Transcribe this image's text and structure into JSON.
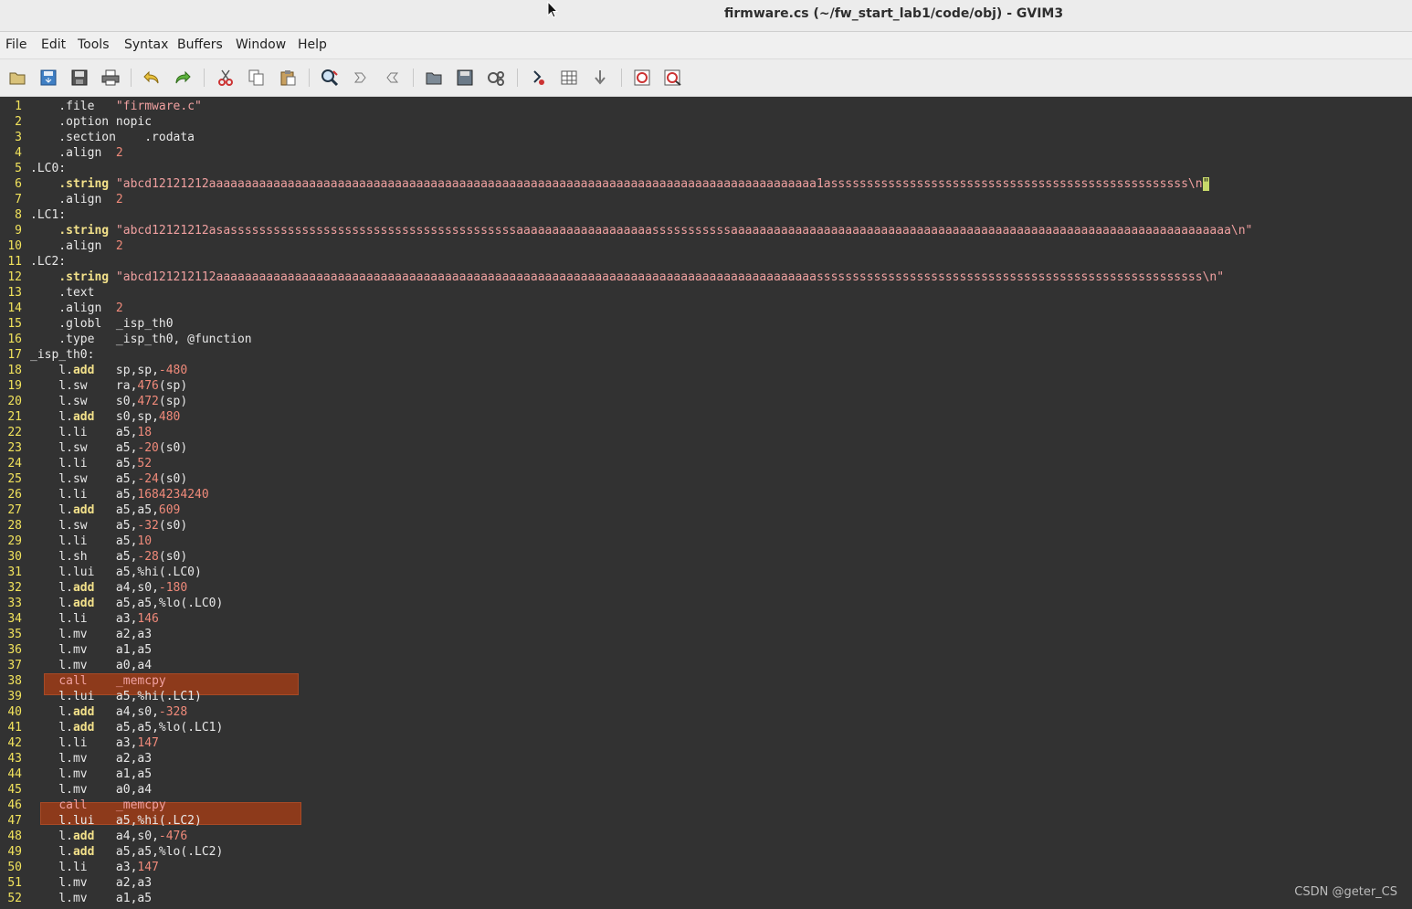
{
  "window": {
    "title": "firmware.cs (~/fw_start_lab1/code/obj) - GVIM3"
  },
  "menu": [
    "File",
    "Edit",
    "Tools",
    "Syntax",
    "Buffers",
    "Window",
    "Help"
  ],
  "toolbar": [
    "open-icon",
    "save-icon",
    "save-all-icon",
    "print-icon",
    "undo-icon",
    "redo-icon",
    "cut-icon",
    "copy-icon",
    "paste-icon",
    "find-replace-icon",
    "find-next-icon",
    "find-prev-icon",
    "load-session-icon",
    "save-session-icon",
    "run-script-icon",
    "make-icon",
    "build-tags-icon",
    "jump-to-tag-icon",
    "help-icon",
    "find-help-icon"
  ],
  "watermark": "CSDN @geter_CS",
  "colors": {
    "linenum": "#f2e35c",
    "keyword": "#f3e18a",
    "string": "#f0a0a0",
    "number": "#f08a7a",
    "highlight": "#8d3a1b",
    "background": "#323232"
  },
  "lines": [
    {
      "n": "1",
      "t": "    .file   \"firmware.c\""
    },
    {
      "n": "2",
      "t": "    .option nopic"
    },
    {
      "n": "3",
      "t": "    .section    .rodata"
    },
    {
      "n": "4",
      "t": "    .align  2"
    },
    {
      "n": "5",
      "t": ".LC0:"
    },
    {
      "n": "6",
      "t": "    .string \"abcd12121212aaaaaaaaaaaaaaaaaaaaaaaaaaaaaaaaaaaaaaaaaaaaaaaaaaaaaaaaaaaaaaaaaaaaaaaaaaaaaaaaaaaaa1assssssssssssssssssssssssssssssssssssssssssssssssss\\n\""
    },
    {
      "n": "7",
      "t": "    .align  2"
    },
    {
      "n": "8",
      "t": ".LC1:"
    },
    {
      "n": "9",
      "t": "    .string \"abcd12121212asassssssssssssssssssssssssssssssssssssssssaaaaaaaaaaaaaaaaaaasssssssssssaaaaaaaaaaaaaaaaaaaaaaaaaaaaaaaaaaaaaaaaaaaaaaaaaaaaaaaaaaaaaaaaaaaaaa\\n\""
    },
    {
      "n": "10",
      "t": "    .align  2"
    },
    {
      "n": "11",
      "t": ".LC2:"
    },
    {
      "n": "12",
      "t": "    .string \"abcd121212112aaaaaaaaaaaaaaaaaaaaaaaaaaaaaaaaaaaaaaaaaaaaaaaaaaaaaaaaaaaaaaaaaaaaaaaaaaaaaaaaaaaassssssssssssssssssssssssssssssssssssssssssssssssssssss\\n\""
    },
    {
      "n": "13",
      "t": "    .text"
    },
    {
      "n": "14",
      "t": "    .align  2"
    },
    {
      "n": "15",
      "t": "    .globl  _isp_th0"
    },
    {
      "n": "16",
      "t": "    .type   _isp_th0, @function"
    },
    {
      "n": "17",
      "t": "_isp_th0:"
    },
    {
      "n": "18",
      "t": "    l.add   sp,sp,-480"
    },
    {
      "n": "19",
      "t": "    l.sw    ra,476(sp)"
    },
    {
      "n": "20",
      "t": "    l.sw    s0,472(sp)"
    },
    {
      "n": "21",
      "t": "    l.add   s0,sp,480"
    },
    {
      "n": "22",
      "t": "    l.li    a5,18"
    },
    {
      "n": "23",
      "t": "    l.sw    a5,-20(s0)"
    },
    {
      "n": "24",
      "t": "    l.li    a5,52"
    },
    {
      "n": "25",
      "t": "    l.sw    a5,-24(s0)"
    },
    {
      "n": "26",
      "t": "    l.li    a5,1684234240"
    },
    {
      "n": "27",
      "t": "    l.add   a5,a5,609"
    },
    {
      "n": "28",
      "t": "    l.sw    a5,-32(s0)"
    },
    {
      "n": "29",
      "t": "    l.li    a5,10"
    },
    {
      "n": "30",
      "t": "    l.sh    a5,-28(s0)"
    },
    {
      "n": "31",
      "t": "    l.lui   a5,%hi(.LC0)"
    },
    {
      "n": "32",
      "t": "    l.add   a4,s0,-180"
    },
    {
      "n": "33",
      "t": "    l.add   a5,a5,%lo(.LC0)"
    },
    {
      "n": "34",
      "t": "    l.li    a3,146"
    },
    {
      "n": "35",
      "t": "    l.mv    a2,a3"
    },
    {
      "n": "36",
      "t": "    l.mv    a1,a5"
    },
    {
      "n": "37",
      "t": "    l.mv    a0,a4"
    },
    {
      "n": "38",
      "t": "    call    _memcpy"
    },
    {
      "n": "39",
      "t": "    l.lui   a5,%hi(.LC1)"
    },
    {
      "n": "40",
      "t": "    l.add   a4,s0,-328"
    },
    {
      "n": "41",
      "t": "    l.add   a5,a5,%lo(.LC1)"
    },
    {
      "n": "42",
      "t": "    l.li    a3,147"
    },
    {
      "n": "43",
      "t": "    l.mv    a2,a3"
    },
    {
      "n": "44",
      "t": "    l.mv    a1,a5"
    },
    {
      "n": "45",
      "t": "    l.mv    a0,a4"
    },
    {
      "n": "46",
      "t": "    call    _memcpy"
    },
    {
      "n": "47",
      "t": "    l.lui   a5,%hi(.LC2)"
    },
    {
      "n": "48",
      "t": "    l.add   a4,s0,-476"
    },
    {
      "n": "49",
      "t": "    l.add   a5,a5,%lo(.LC2)"
    },
    {
      "n": "50",
      "t": "    l.li    a3,147"
    },
    {
      "n": "51",
      "t": "    l.mv    a2,a3"
    },
    {
      "n": "52",
      "t": "    l.mv    a1,a5"
    }
  ]
}
